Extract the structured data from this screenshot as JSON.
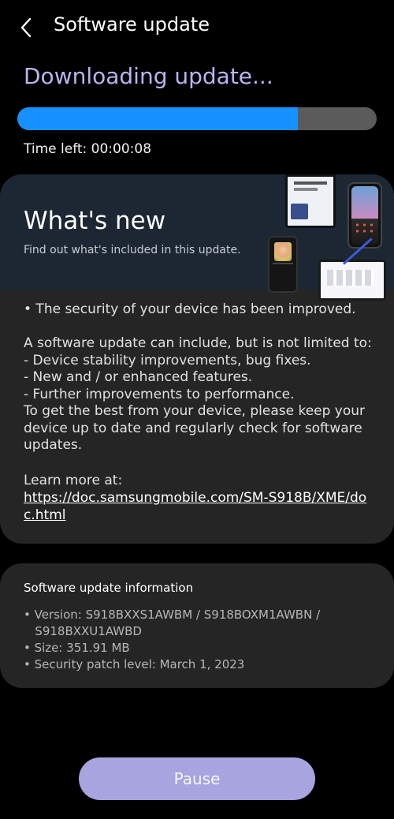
{
  "header": {
    "title": "Software update",
    "back_icon": "chevron-left-icon"
  },
  "status": {
    "title": "Downloading update...",
    "progress_percent": 78,
    "time_left": "Time left: 00:00:08"
  },
  "whats_new": {
    "title": "What's new",
    "subtitle": "Find out what's included in this update.",
    "body": "• The security of your device has been improved.\n\nA software update can include, but is not limited to:\n - Device stability improvements, bug fixes.\n - New and / or enhanced features.\n - Further improvements to performance.\nTo get the best from your device, please keep your device up to date and regularly check for software updates.",
    "learn_more": "Learn more at:",
    "link": "https://doc.samsungmobile.com/SM-S918B/XME/doc.html"
  },
  "update_info": {
    "title": "Software update information",
    "items": [
      "• Version: S918BXXS1AWBM / S918BOXM1AWBN /",
      "   S918BXXU1AWBD",
      "• Size: 351.91 MB",
      "• Security patch level: March 1, 2023"
    ]
  },
  "actions": {
    "pause_label": "Pause"
  },
  "colors": {
    "accent": "#1592ff",
    "title": "#b9b5f2",
    "button": "#a7a4e0"
  }
}
